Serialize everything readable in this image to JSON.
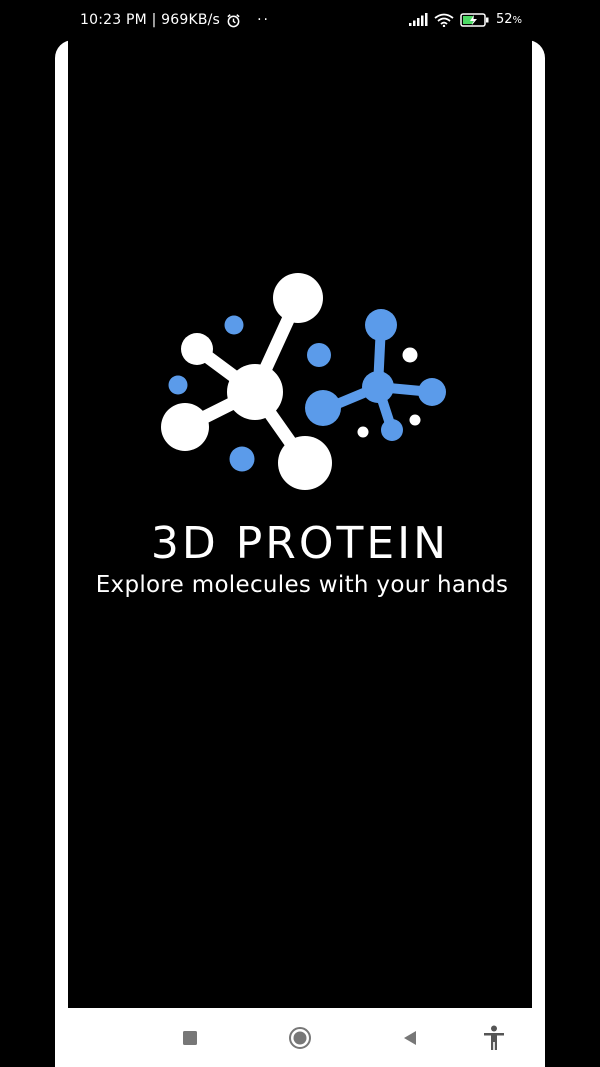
{
  "status_bar": {
    "time_speed": "10:23 PM | 969KB/s",
    "overflow_dots": "··",
    "battery_percent": "52",
    "battery_unit": "%"
  },
  "splash": {
    "title": "3D PROTEIN",
    "tagline": "Explore molecules with your hands",
    "logo_colors": {
      "primary": "#ffffff",
      "accent": "#5b9bea"
    }
  },
  "nav_bar": {
    "icons": [
      "recent-apps-icon",
      "home-icon",
      "back-icon",
      "accessibility-icon"
    ]
  }
}
